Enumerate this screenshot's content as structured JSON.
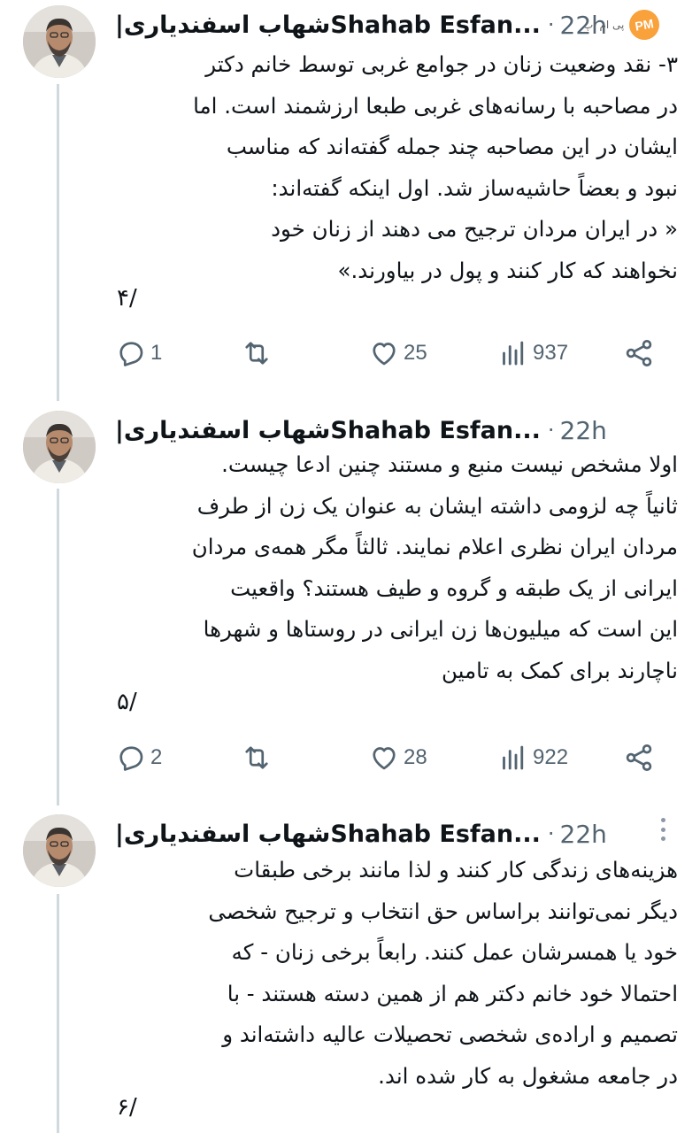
{
  "watermark": {
    "site_text": "پی ام اپ",
    "badge_text": "PM"
  },
  "tweets": [
    {
      "author_name_fa": "شهاب اسفندیاری|",
      "author_name_en": "Shahab Esfan...",
      "time": "22h",
      "lines": [
        "۳- نقد وضعیت زنان در جوامع غربی توسط خانم دکتر",
        "در مصاحبه با رسانه‌های غربی طبعا ارزشمند است. اما",
        "ایشان در این مصاحبه چند جمله گفته‌اند که مناسب",
        "نبود و بعضاً حاشیه‌ساز شد. اول اینکه گفته‌اند:",
        "« در ایران مردان ترجیح می دهند از زنان خود",
        "نخواهند که کار کنند و پول در بیاورند.»"
      ],
      "counter": "۴/",
      "replies": "1",
      "retweets": "",
      "likes": "25",
      "views": "937"
    },
    {
      "author_name_fa": "شهاب اسفندیاری|",
      "author_name_en": "Shahab Esfan...",
      "time": "22h",
      "lines": [
        "اولا مشخص نیست منبع و مستند چنین ادعا چیست.",
        "ثانیاً چه لزومی داشته ایشان به عنوان یک زن از طرف",
        "مردان ایران نظری اعلام نمایند. ثالثاً مگر همه‌ی مردان",
        "ایرانی از یک طبقه و گروه و طیف هستند؟ واقعیت",
        "این است که میلیون‌ها زن ایرانی در روستاها و شهرها",
        "ناچارند برای کمک به تامین"
      ],
      "counter": "۵/",
      "replies": "2",
      "retweets": "",
      "likes": "28",
      "views": "922"
    },
    {
      "author_name_fa": "شهاب اسفندیاری|",
      "author_name_en": "Shahab Esfan...",
      "time": "22h",
      "lines": [
        "هزینه‌های زندگی کار کنند و لذا مانند برخی طبقات",
        "دیگر نمی‌توانند براساس حق انتخاب و ترجیح شخصی",
        "خود یا همسرشان عمل کنند. رابعاً برخی زنان - که",
        "احتمالا خود خانم دکتر هم از همین دسته هستند - با",
        "تصمیم و اراده‌ی شخصی تحصیلات عالیه داشته‌اند و",
        "در جامعه مشغول به کار شده اند."
      ],
      "counter": "۶/"
    }
  ]
}
